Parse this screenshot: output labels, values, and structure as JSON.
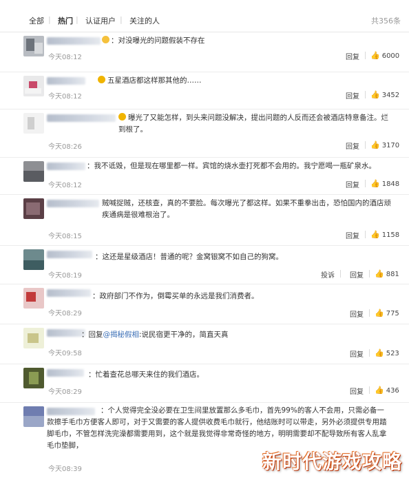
{
  "tabs": [
    {
      "label": "全部"
    },
    {
      "label": "热门"
    },
    {
      "label": "认证用户"
    },
    {
      "label": "关注的人"
    }
  ],
  "total_label": "共356条",
  "reply_label": "回复",
  "report_label": "投诉",
  "comments": [
    {
      "text": "：对没曝光的问题假装不存在",
      "time": "今天08:12",
      "likes": "6000"
    },
    {
      "text": "五星酒店都这样那其他的……",
      "time": "今天08:12",
      "likes": "3452"
    },
    {
      "text": "曝光了又能怎样，到头来问题没解决，提出问题的人反而还会被酒店特意备注。烂到根了。",
      "time": "今天08:26",
      "likes": "3170"
    },
    {
      "text": "：我不诋毁，但是现在哪里都一样。宾馆的烧水壶打死都不会用的。我宁愿喝一瓶矿泉水。",
      "time": "今天08:12",
      "likes": "1848"
    },
    {
      "text": "贼喊捉贼，还核查，真的不要脸。每次曝光了都这样。如果不重拳出击，恐怕国内的酒店顽疾通病是很难根治了。",
      "time": "今天08:15",
      "likes": "1158"
    },
    {
      "text": "：这还是星级酒店！普通的呢？金窝银窝不如自己的狗窝。",
      "time": "今天08:19",
      "likes": "881"
    },
    {
      "text": "：政府部门不作为，倒霉买单的永远是我们消费者。",
      "time": "今天08:29",
      "likes": "775"
    },
    {
      "prefix": "：回复",
      "at": "@揭秘假相",
      "text": ":说民宿更干净的，简直天真",
      "time": "今天09:58",
      "likes": "523"
    },
    {
      "text": "：忙着查花总哪天来住的我们酒店。",
      "time": "今天08:29",
      "likes": "436"
    },
    {
      "text": "：个人觉得完全没必要在卫生间里放置那么多毛巾，首先99%的客人不会用，只需必备一款擦手毛巾方便客人即可，对于又需要的客人提供收费毛巾就行，他结账时可以带走，另外必须提供专用踏脚毛巾，不管怎样洗完澡都需要用到，这个就是我觉得非常奇怪的地方，明明需要却不配导致所有客人乱拿毛巾垫脚，",
      "time": "今天08:39",
      "likes": ""
    }
  ],
  "watermark": "新时代游戏攻略"
}
